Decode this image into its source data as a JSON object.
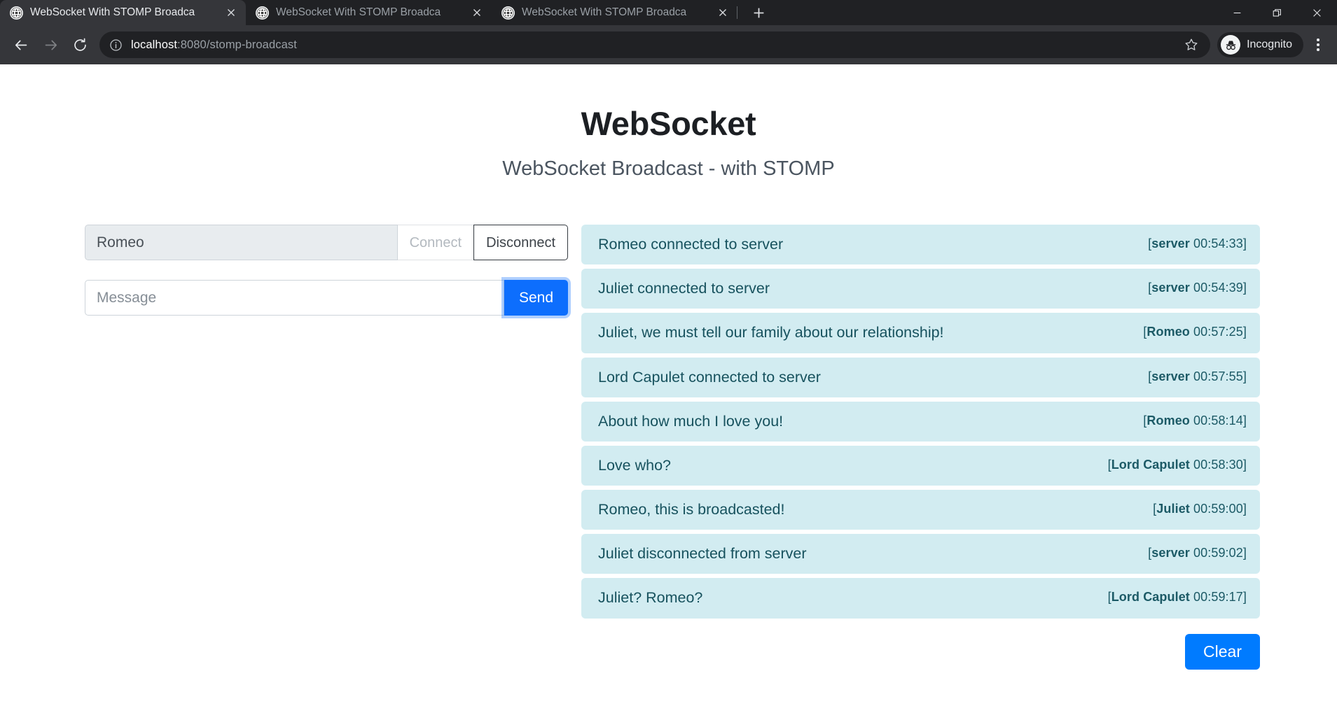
{
  "browser": {
    "tabs": [
      {
        "title": "WebSocket With STOMP Broadca",
        "active": true
      },
      {
        "title": "WebSocket With STOMP Broadca",
        "active": false
      },
      {
        "title": "WebSocket With STOMP Broadca",
        "active": false
      }
    ],
    "new_tab_tooltip": "New Tab",
    "window_controls": {
      "minimize": "Minimize",
      "restore": "Restore",
      "close": "Close"
    },
    "nav": {
      "back": "Back",
      "forward": "Forward",
      "reload": "Reload"
    },
    "omnibox": {
      "host": "localhost",
      "path": ":8080/stomp-broadcast",
      "full_url": "localhost:8080/stomp-broadcast",
      "site_info": "View site information"
    },
    "bookmark": "Bookmark this tab",
    "profile": {
      "label": "Incognito"
    },
    "menu": "Customize and control Google Chrome"
  },
  "page": {
    "title": "WebSocket",
    "subtitle": "WebSocket Broadcast - with STOMP",
    "form": {
      "name_value": "Romeo",
      "name_placeholder": "Name",
      "connect_label": "Connect",
      "disconnect_label": "Disconnect",
      "message_value": "",
      "message_placeholder": "Message",
      "send_label": "Send"
    },
    "messages": [
      {
        "text": "Romeo connected to server",
        "author": "server",
        "time": "00:54:33"
      },
      {
        "text": "Juliet connected to server",
        "author": "server",
        "time": "00:54:39"
      },
      {
        "text": "Juliet, we must tell our family about our relationship!",
        "author": "Romeo",
        "time": "00:57:25"
      },
      {
        "text": "Lord Capulet connected to server",
        "author": "server",
        "time": "00:57:55"
      },
      {
        "text": "About how much I love you!",
        "author": "Romeo",
        "time": "00:58:14"
      },
      {
        "text": "Love who?",
        "author": "Lord Capulet",
        "time": "00:58:30"
      },
      {
        "text": "Romeo, this is broadcasted!",
        "author": "Juliet",
        "time": "00:59:00"
      },
      {
        "text": "Juliet disconnected from server",
        "author": "server",
        "time": "00:59:02"
      },
      {
        "text": "Juliet? Romeo?",
        "author": "Lord Capulet",
        "time": "00:59:17"
      }
    ],
    "clear_label": "Clear"
  },
  "colors": {
    "accent_blue": "#007bff",
    "send_blue": "#0d6efd",
    "message_bg": "#d2ecf1",
    "message_text": "#17525e",
    "chrome_dark": "#202124",
    "toolbar_dark": "#35363a"
  }
}
